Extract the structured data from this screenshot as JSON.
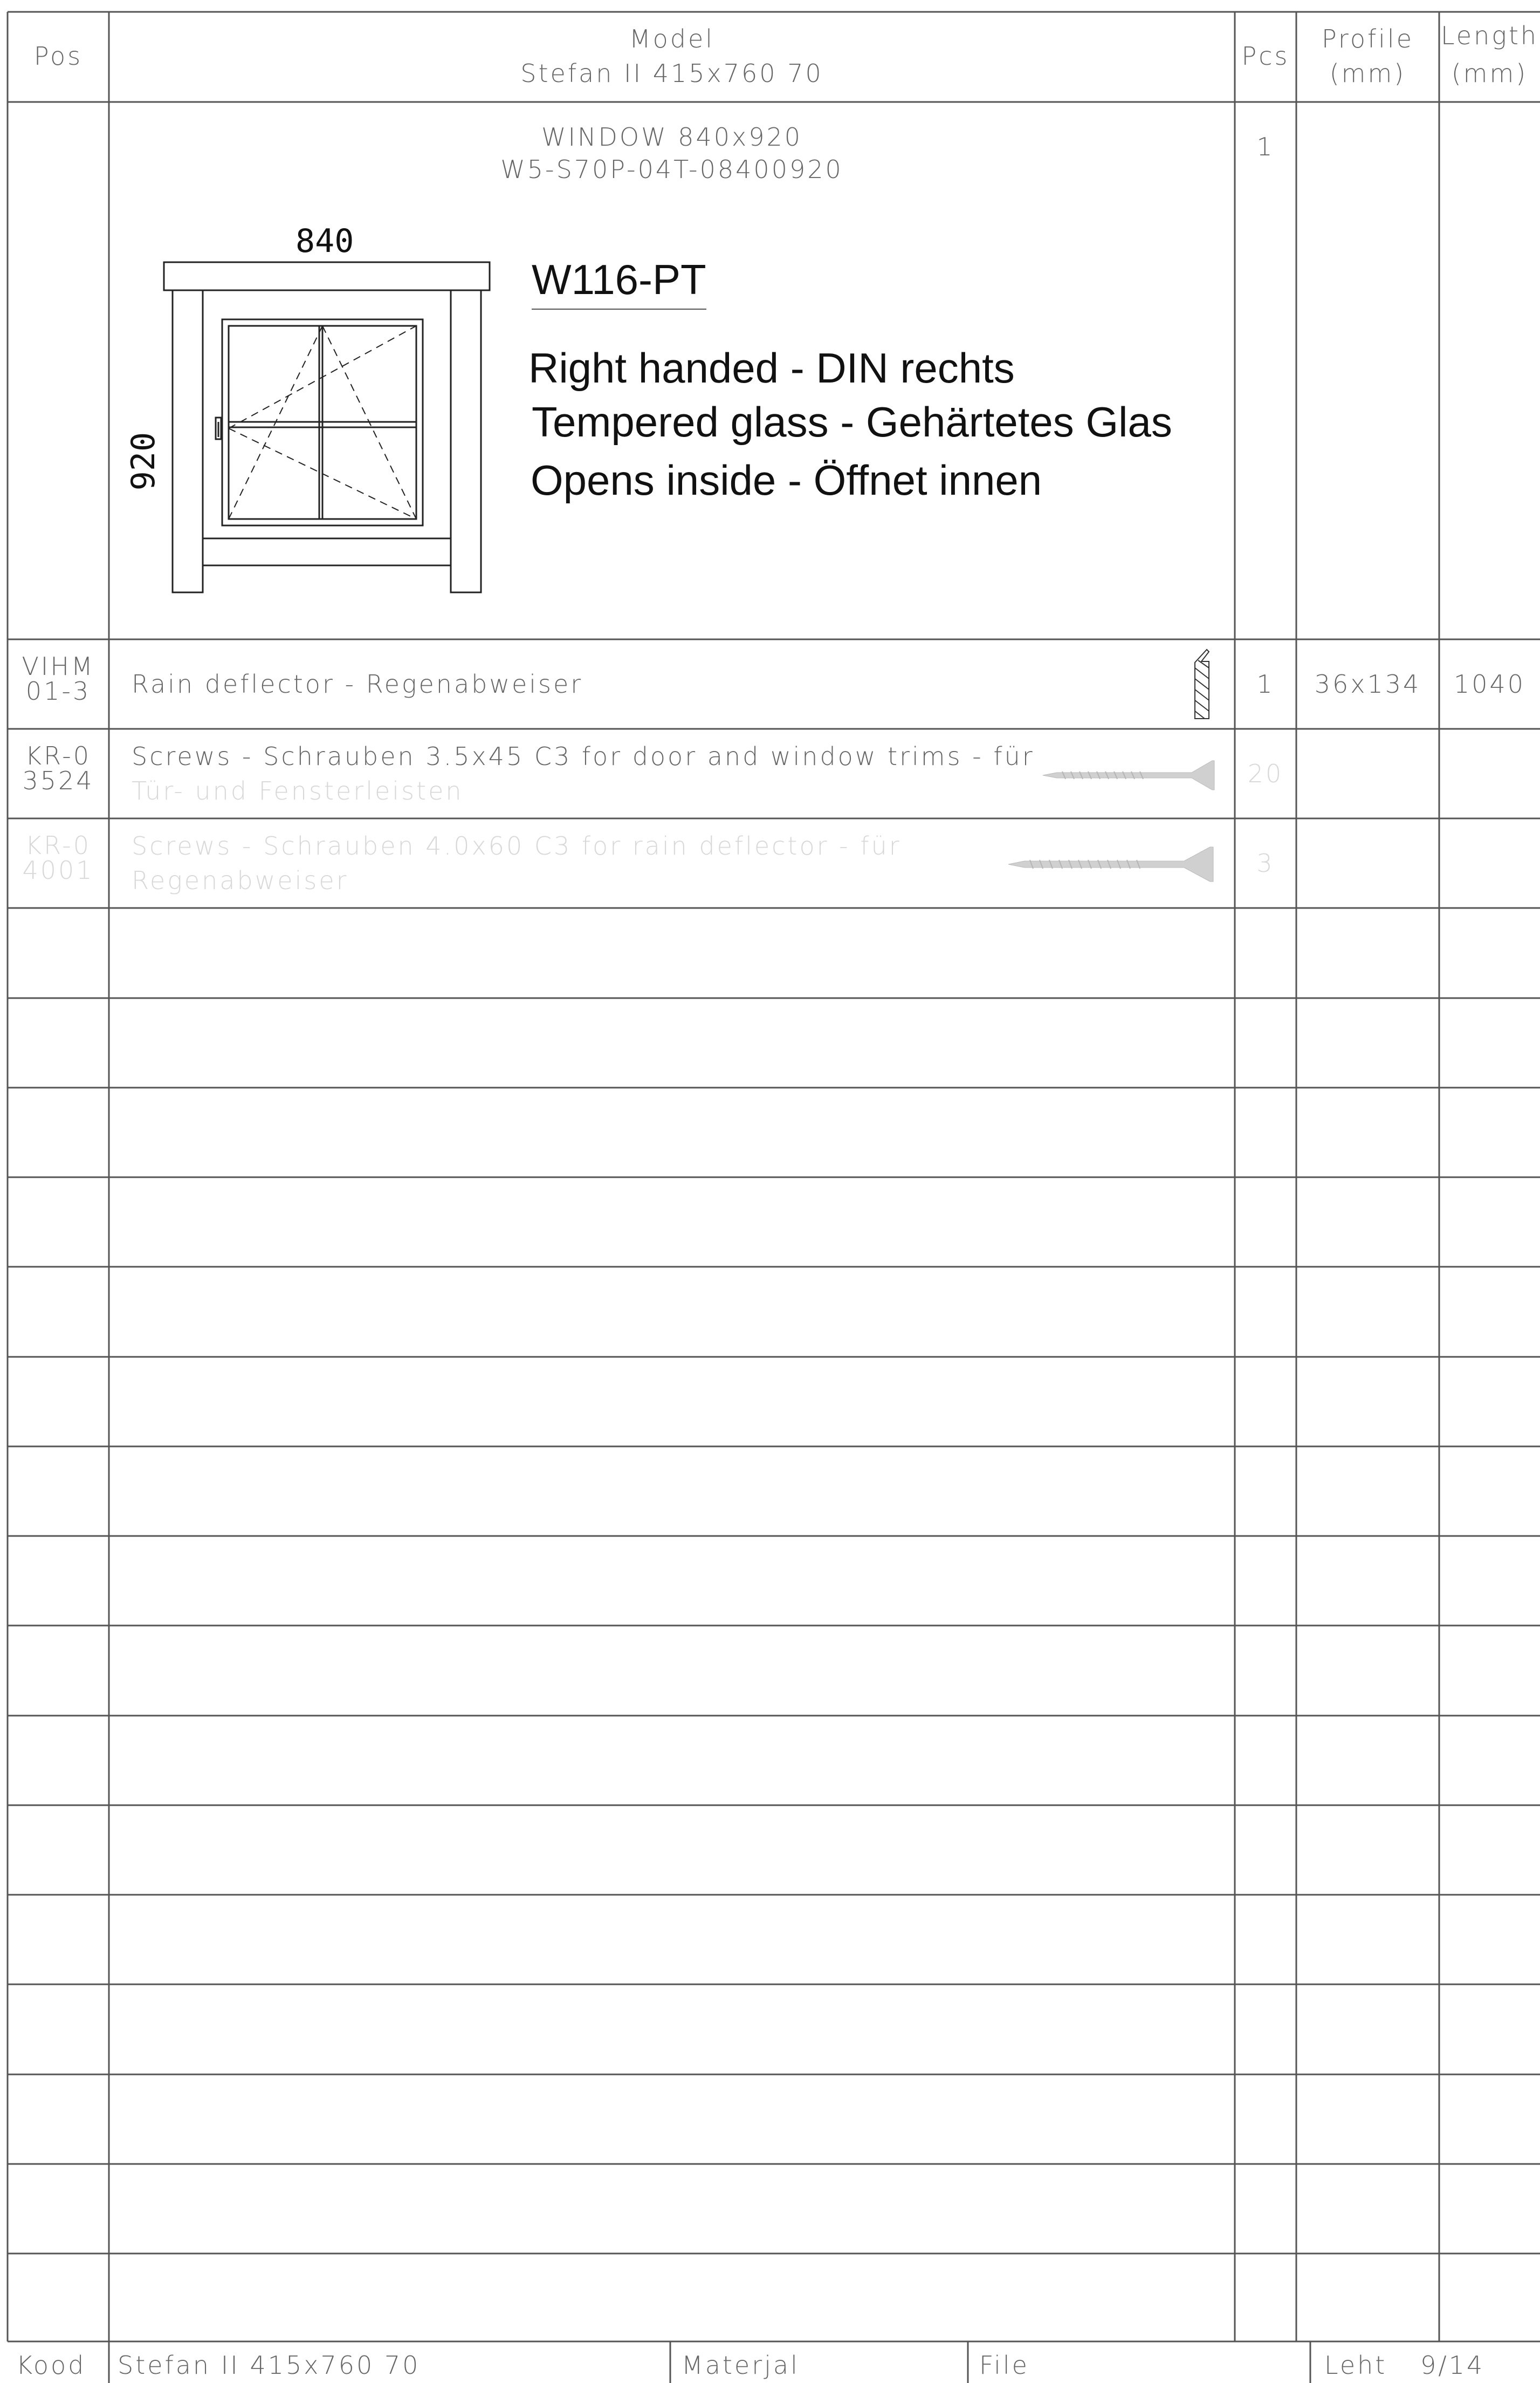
{
  "header": {
    "pos": "Pos",
    "model_label": "Model",
    "model_name": "Stefan II 415x760 70",
    "pcs": "Pcs",
    "profile": "Profile",
    "profile_unit": "(mm)",
    "length": "Length",
    "length_unit": "(mm)"
  },
  "window": {
    "title": "WINDOW 840x920",
    "code": "W5-S70P-04T-08400920",
    "pcs": "1",
    "width_dim": "840",
    "height_dim": "920",
    "ref": "W116-PT",
    "notes": [
      "Right handed - DIN rechts",
      "Tempered glass - Gehärtetes Glas",
      "Opens inside - Öffnet innen"
    ]
  },
  "rows": [
    {
      "pos_line1": "VIHM",
      "pos_line2": "01-3",
      "desc_line1": "Rain deflector - Regenabweiser",
      "desc_line2": "",
      "icon": "rain-deflector-icon",
      "pcs": "1",
      "profile": "36x134",
      "length": "1040"
    },
    {
      "pos_line1": "KR-0",
      "pos_line2": "3524",
      "desc_line1": "Screws - Schrauben 3.5x45 C3   for door and window trims - für",
      "desc_line2": "Tür- und Fensterleisten",
      "icon": "screw-icon",
      "pcs": "20",
      "profile": "",
      "length": ""
    },
    {
      "pos_line1": "KR-0",
      "pos_line2": "4001",
      "desc_line1": "Screws - Schrauben 4.0x60 C3   for rain deflector - für",
      "desc_line2": "Regenabweiser",
      "icon": "screw-icon",
      "pcs": "3",
      "profile": "",
      "length": ""
    }
  ],
  "footer": {
    "kood": "Kood",
    "model_name": "Stefan II 415x760 70",
    "materjal": "Materjal",
    "file": "File",
    "leht": "Leht",
    "page": "9/14"
  },
  "colors": {
    "line": "#555555",
    "faded_text": "#d8d8d8",
    "note_text": "#111111"
  }
}
